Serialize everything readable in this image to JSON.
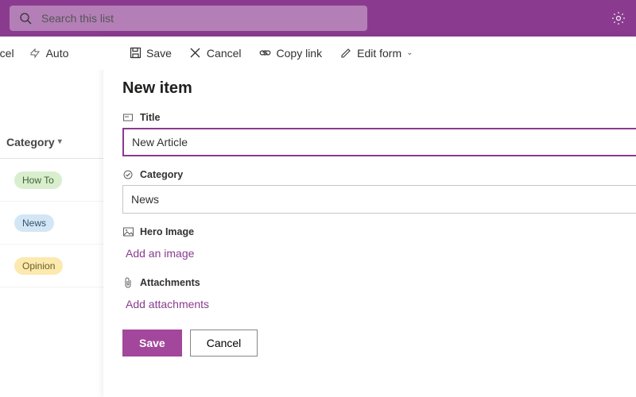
{
  "search": {
    "placeholder": "Search this list"
  },
  "commandbar_left": {
    "export": "t to Excel",
    "automate": "Auto"
  },
  "panel_toolbar": {
    "save": "Save",
    "cancel": "Cancel",
    "copy_link": "Copy link",
    "edit_form": "Edit form"
  },
  "list_column": "Category",
  "list_rows": [
    {
      "label": "How To",
      "cls": "pill-green"
    },
    {
      "label": "News",
      "cls": "pill-blue"
    },
    {
      "label": "Opinion",
      "cls": "pill-yellow"
    }
  ],
  "panel": {
    "title": "New item",
    "fields": {
      "title_label": "Title",
      "title_value": "New Article",
      "category_label": "Category",
      "category_value": "News",
      "hero_label": "Hero Image",
      "hero_action": "Add an image",
      "attach_label": "Attachments",
      "attach_action": "Add attachments"
    },
    "buttons": {
      "save": "Save",
      "cancel": "Cancel"
    }
  }
}
